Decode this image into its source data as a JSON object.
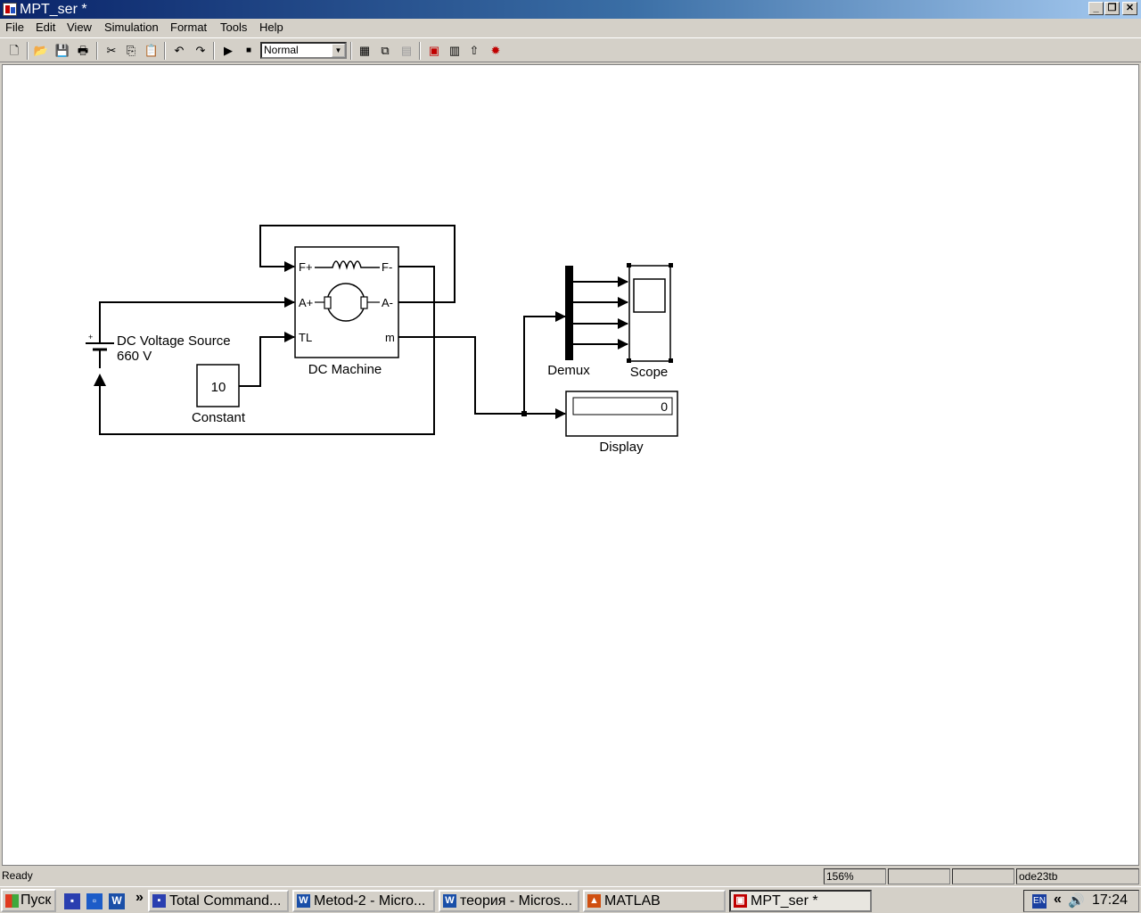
{
  "window": {
    "title": "MPT_ser *"
  },
  "menu": [
    "File",
    "Edit",
    "View",
    "Simulation",
    "Format",
    "Tools",
    "Help"
  ],
  "toolbar": {
    "sim_mode": "Normal"
  },
  "diagram": {
    "dc_source_label_line1": "DC Voltage Source",
    "dc_source_label_line2": "660 V",
    "dc_source_plus": "+",
    "machine_label": "DC Machine",
    "machine_ports": {
      "f_plus": "F+",
      "f_minus": "F-",
      "a_plus": "A+",
      "a_minus": "A-",
      "tl": "TL",
      "m": "m"
    },
    "constant_value": "10",
    "constant_label": "Constant",
    "demux_label": "Demux",
    "scope_label": "Scope",
    "display_value": "0",
    "display_label": "Display"
  },
  "status": {
    "state": "Ready",
    "zoom": "156%",
    "solver": "ode23tb"
  },
  "taskbar": {
    "start": "Пуск",
    "overflow": "»",
    "items": [
      "Total Command...",
      "Metod-2 - Micro...",
      "теория - Micros...",
      "MATLAB",
      "MPT_ser *"
    ],
    "lang": "EN",
    "tray_chevron": "«",
    "clock": "17:24"
  }
}
